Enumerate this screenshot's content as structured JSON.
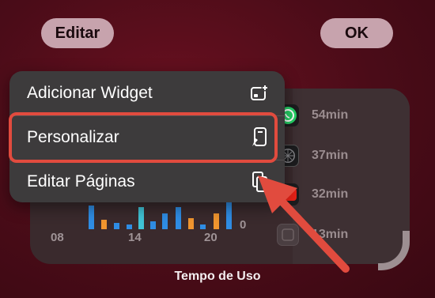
{
  "header": {
    "edit_label": "Editar",
    "ok_label": "OK"
  },
  "menu": {
    "items": [
      {
        "label": "Adicionar Widget",
        "icon": "add-widget-icon"
      },
      {
        "label": "Personalizar",
        "icon": "customize-brush-icon"
      },
      {
        "label": "Editar Páginas",
        "icon": "edit-pages-icon"
      }
    ]
  },
  "widget": {
    "title": "Tempo de Uso",
    "apps": [
      {
        "name": "WhatsApp",
        "time": "54min",
        "icon": "whatsapp-icon"
      },
      {
        "name": "Safari",
        "time": "37min",
        "icon": "safari-icon"
      },
      {
        "name": "YouTube",
        "time": "32min",
        "icon": "youtube-icon"
      },
      {
        "name": "App",
        "time": "13min",
        "icon": "app-icon"
      }
    ],
    "chart": {
      "x_ticks": [
        "08",
        "14",
        "20"
      ],
      "y_zero": "0"
    }
  },
  "colors": {
    "highlight": "#e14b3e",
    "arrow": "#e14b3e",
    "bar_blue": "#2f8de4",
    "bar_teal": "#40c3d6",
    "bar_orange": "#f1962f"
  }
}
